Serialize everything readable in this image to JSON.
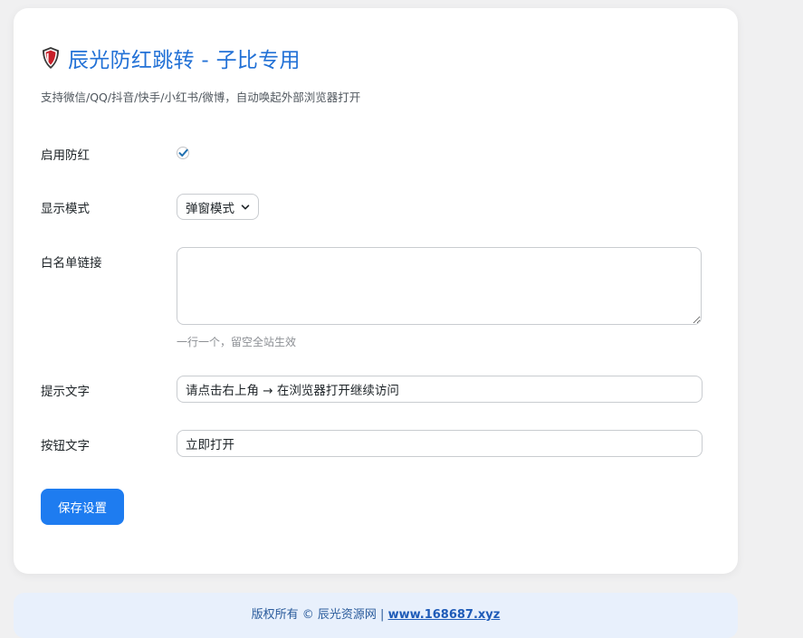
{
  "header": {
    "title": "辰光防红跳转 - 子比专用",
    "subtitle": "支持微信/QQ/抖音/快手/小红书/微博，自动唤起外部浏览器打开",
    "icon": "shield-icon"
  },
  "form": {
    "enable": {
      "label": "启用防红",
      "checked": true
    },
    "display_mode": {
      "label": "显示模式",
      "value": "弹窗模式"
    },
    "whitelist": {
      "label": "白名单链接",
      "value": "",
      "hint": "一行一个，留空全站生效"
    },
    "tip_text": {
      "label": "提示文字",
      "value": "请点击右上角 → 在浏览器打开继续访问"
    },
    "button_text": {
      "label": "按钮文字",
      "value": "立即打开"
    },
    "save_label": "保存设置"
  },
  "footer": {
    "text": "版权所有 © 辰光资源网 | ",
    "link_text": "www.168687.xyz"
  },
  "colors": {
    "accent": "#1e7cf0",
    "title": "#2271d6",
    "shield_red": "#c8202a",
    "footer_bg": "#e8f0fc"
  }
}
